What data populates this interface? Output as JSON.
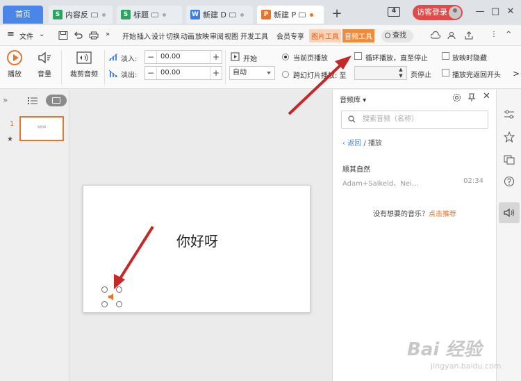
{
  "tabs": {
    "home": "首页",
    "documents": [
      {
        "label": "内容反",
        "app": "S",
        "color": "#27a55a"
      },
      {
        "label": "标题",
        "app": "S",
        "color": "#27a55a"
      },
      {
        "label": "新建 D",
        "app": "W",
        "color": "#3d7de4"
      },
      {
        "label": "新建 P",
        "app": "P",
        "color": "#e8742c"
      }
    ],
    "add": "+"
  },
  "titlebar": {
    "tab_count": "4",
    "login_label": "访客登录",
    "minimize": "—",
    "maximize": "□",
    "close": "✕"
  },
  "menubar": {
    "hamburger": "≡",
    "file_menu": "文件",
    "more_left": "»",
    "items": [
      "开始",
      "插入",
      "设计",
      "切换",
      "动画",
      "放映",
      "审阅",
      "视图",
      "开发工具",
      "会员专享",
      "图片工具",
      "音频工具"
    ],
    "active_tab": "音频工具",
    "search_label": "查找",
    "more_right": "⋮",
    "collapse": "^"
  },
  "ribbon": {
    "play_label": "播放",
    "volume_label": "音量",
    "trim_label": "裁剪音频",
    "fade_in_label": "淡入:",
    "fade_in_value": "00.00",
    "fade_out_label": "淡出:",
    "fade_out_value": "00.00",
    "start_label": "开始",
    "start_value": "自动",
    "radio_current": "当前页播放",
    "radio_across": "跨幻灯片播放: 至",
    "page_stop_label": "页停止",
    "loop_label": "循环播放，直至停止",
    "hide_label": "放映时隐藏",
    "rewind_label": "播放完返回开头",
    "more": ">"
  },
  "leftpanel": {
    "expand": "»",
    "slide_number": "1",
    "star": "★",
    "thumb_text": "你好呀"
  },
  "slide": {
    "text": "你好呀"
  },
  "library": {
    "title": "音频库",
    "search_placeholder": "搜索音频（名称）",
    "back": "返回",
    "crumb_sep": "/",
    "crumb_current": "播放",
    "song_title": "顺其自然",
    "song_artist": "Adam+Salkeld、Nei...",
    "song_duration": "02:34",
    "empty_text": "没有想要的音乐？",
    "empty_link": "点击推荐"
  },
  "watermark": {
    "main": "Bai 经验",
    "sub": "jingyan.baidu.com"
  },
  "colors": {
    "accent": "#e8742c",
    "arrow": "#c62828",
    "primary": "#4a86e8"
  }
}
